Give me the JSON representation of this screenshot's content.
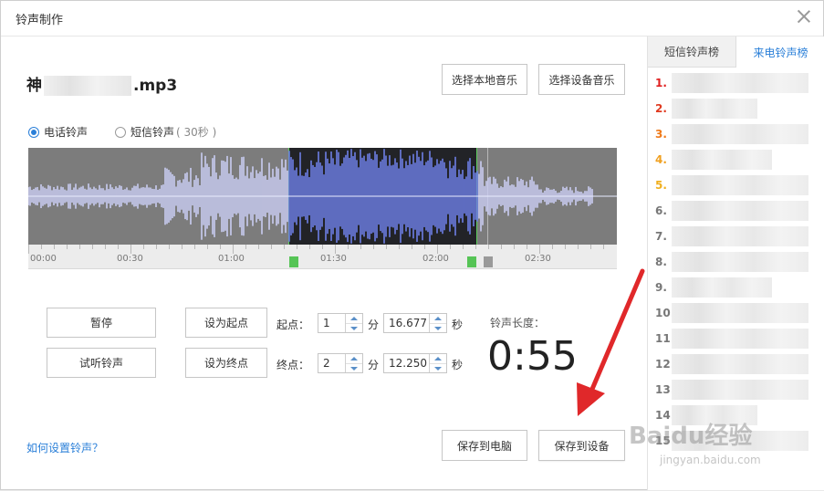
{
  "window": {
    "title": "铃声制作"
  },
  "file": {
    "name_prefix": "神",
    "name_suffix": ".mp3"
  },
  "buttons": {
    "choose_local": "选择本地音乐",
    "choose_device": "选择设备音乐",
    "pause": "暂停",
    "preview": "试听铃声",
    "set_start": "设为起点",
    "set_end": "设为终点",
    "save_pc": "保存到电脑",
    "save_device": "保存到设备"
  },
  "ringtone_type": {
    "call": "电话铃声",
    "sms": "短信铃声",
    "sms_note": "( 30秒 )",
    "selected": "电话铃声"
  },
  "timeline": {
    "labels": [
      "00:00",
      "00:30",
      "01:00",
      "01:30",
      "02:00",
      "02:30"
    ]
  },
  "start": {
    "label": "起点：",
    "min": "1",
    "min_unit": "分",
    "sec": "16.677",
    "sec_unit": "秒"
  },
  "end": {
    "label": "终点：",
    "min": "2",
    "min_unit": "分",
    "sec": "12.250",
    "sec_unit": "秒"
  },
  "length": {
    "label": "铃声长度：",
    "value": "0:55"
  },
  "help_link": "如何设置铃声？",
  "sidebar": {
    "tabs": [
      "短信铃声榜",
      "来电铃声榜"
    ],
    "active_tab": "来电铃声榜",
    "ranks": [
      "1.",
      "2.",
      "3.",
      "4.",
      "5.",
      "6.",
      "7.",
      "8.",
      "9.",
      "10.",
      "11.",
      "12.",
      "13.",
      "14.",
      "15."
    ]
  },
  "colors": {
    "accent": "#2a7fd8",
    "rank1": "#e02020",
    "rank2": "#e03a20",
    "rank3": "#ef7a1a",
    "rank4": "#f0a020",
    "rank5": "#f0b020",
    "arrow": "#e0282a",
    "selection_border": "#5ecf5e"
  },
  "watermark": {
    "text": "Baidu经验",
    "url_text": "jingyan.baidu.com"
  }
}
